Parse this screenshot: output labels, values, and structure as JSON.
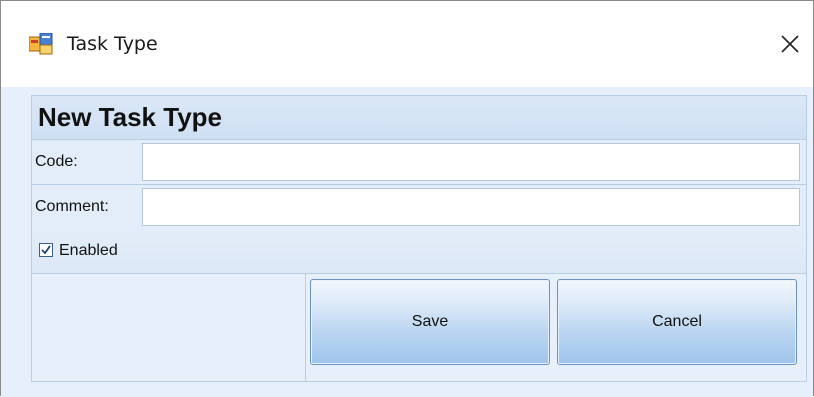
{
  "window": {
    "title": "Task Type",
    "app_icon": "form-icon",
    "close_icon": "close-icon"
  },
  "form": {
    "header": "New Task Type",
    "fields": [
      {
        "label": "Code:",
        "value": ""
      },
      {
        "label": "Comment:",
        "value": ""
      }
    ],
    "enabled": {
      "label": "Enabled",
      "checked": true
    }
  },
  "buttons": {
    "save_label": "Save",
    "cancel_label": "Cancel"
  },
  "colors": {
    "panel_bg": "#e6effa",
    "border": "#b9cde3",
    "button_border": "#6a93c4",
    "button_gradient_bottom": "#9fc4ec"
  }
}
